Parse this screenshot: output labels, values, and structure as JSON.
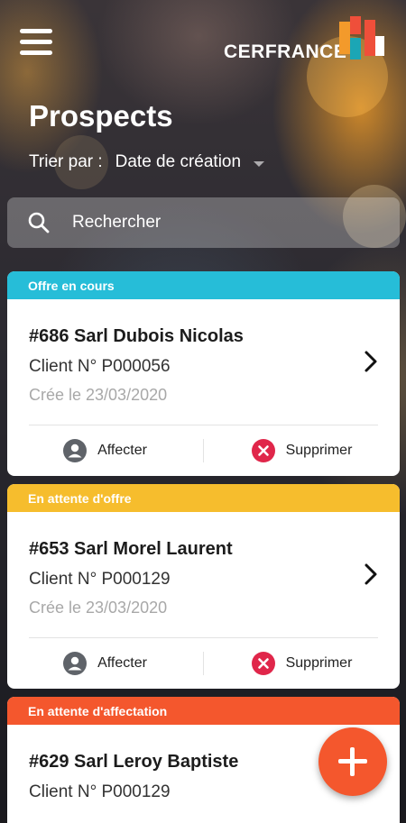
{
  "header": {
    "logo_text": "CERFRANCE",
    "menu_icon": "hamburger-menu-icon"
  },
  "page": {
    "title": "Prospects",
    "sort_label": "Trier par :",
    "sort_value": "Date de création"
  },
  "search": {
    "placeholder": "Rechercher",
    "icon": "search-icon"
  },
  "prospects": [
    {
      "status": "Offre en cours",
      "status_color": "#26bdd8",
      "title": "#686 Sarl Dubois Nicolas",
      "client": "Client N° P000056",
      "created": "Crée le 23/03/2020",
      "assign_label": "Affecter",
      "delete_label": "Supprimer"
    },
    {
      "status": "En attente d'offre",
      "status_color": "#f6bd2d",
      "title": "#653 Sarl Morel Laurent",
      "client": "Client N° P000129",
      "created": "Crée le 23/03/2020",
      "assign_label": "Affecter",
      "delete_label": "Supprimer"
    },
    {
      "status": "En attente d'affectation",
      "status_color": "#f4572d",
      "title": "#629 Sarl Leroy Baptiste",
      "client": "Client N° P000129"
    }
  ],
  "colors": {
    "delete_red": "#e0264a",
    "assign_grey": "#5f6369",
    "fab_orange": "#f4572d"
  },
  "fab": {
    "icon": "plus-icon"
  }
}
